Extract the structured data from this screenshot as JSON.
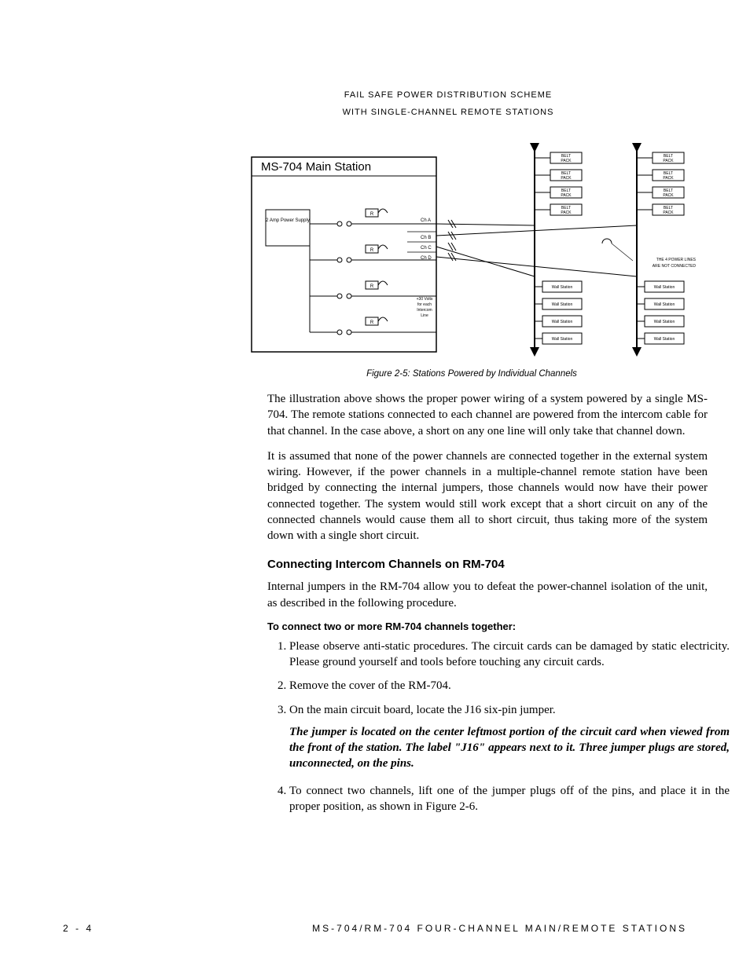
{
  "header": {
    "line1": "FAIL SAFE POWER DISTRIBUTION SCHEME",
    "line2": "WITH SINGLE-CHANNEL REMOTE STATIONS"
  },
  "figure": {
    "title": "MS-704 Main Station",
    "power_supply": "2 Amp Power Supply",
    "fuse_label": "R",
    "channels": [
      "Ch A",
      "Ch B",
      "Ch C",
      "Ch D"
    ],
    "voltage_note_l1": "+30 Volts",
    "voltage_note_l2": "for each",
    "voltage_note_l3": "Intercom",
    "voltage_note_l4": "Line",
    "belt_pack_l1": "BELT",
    "belt_pack_l2": "PACK",
    "wall_station": "Wall Station",
    "not_connected_l1": "THE 4 POWER LINES",
    "not_connected_l2": "ARE NOT CONNECTED",
    "caption": "Figure 2-5: Stations Powered by Individual Channels"
  },
  "paras": {
    "p1": "The illustration above shows the proper power wiring of a system powered by a single MS-704. The remote stations connected to each channel are powered from the intercom cable for that channel. In the case above, a short on any one line will only take that channel down.",
    "p2": "It is assumed that none of the power channels are connected together in the external system wiring. However, if the power channels in a multiple-channel remote station have been bridged by connecting the internal jumpers, those channels would now have their power connected together. The system would still work except that a short circuit on any of the connected channels would cause them all to short circuit, thus taking more of the system down with a single short circuit."
  },
  "section": {
    "heading": "Connecting Intercom Channels on RM-704",
    "intro": "Internal jumpers in the RM-704 allow you to defeat the power-channel isolation of the unit, as described in the following procedure.",
    "subhead": "To connect two or more RM-704 channels together:"
  },
  "steps": {
    "s1": "Please observe anti-static procedures. The circuit cards can be damaged by static electricity. Please ground yourself and tools before touching any circuit cards.",
    "s2": "Remove the cover of the RM-704.",
    "s3": "On the main circuit board, locate the J16 six-pin jumper.",
    "s3_note": "The jumper is located on the center leftmost portion of the circuit card when viewed from the front of the station.  The label \"J16\" appears next to it.  Three jumper plugs are stored, unconnected, on the pins.",
    "s4": "To connect two channels, lift one of the jumper plugs off of the pins, and place it in the proper position, as shown in Figure 2-6."
  },
  "footer": {
    "page": "2 - 4",
    "title": "MS-704/RM-704 FOUR-CHANNEL MAIN/REMOTE STATIONS"
  }
}
